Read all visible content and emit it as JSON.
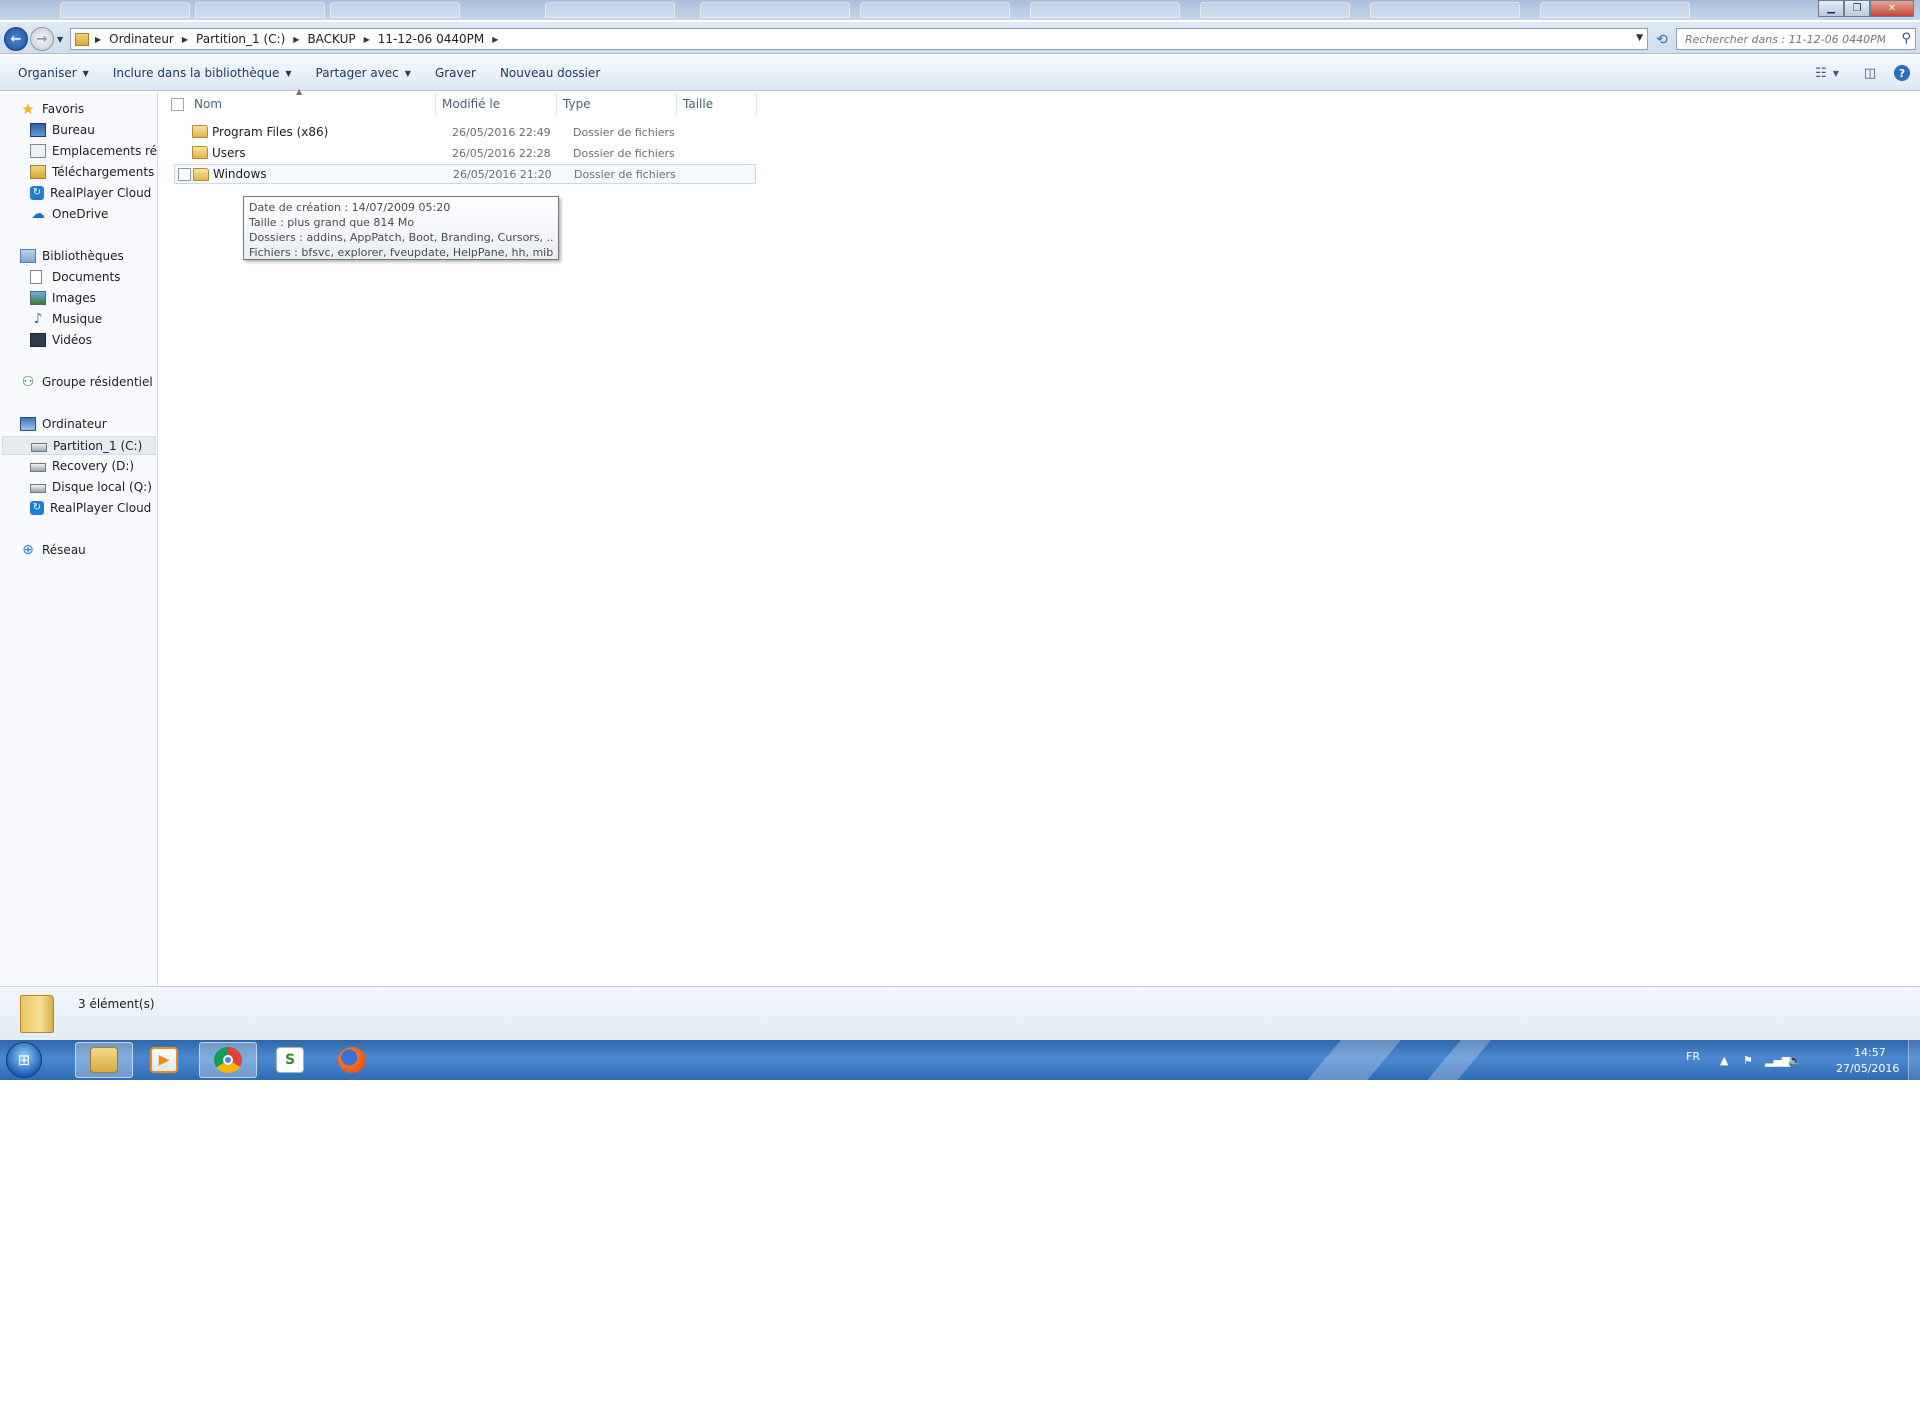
{
  "window": {
    "breadcrumbs": [
      "Ordinateur",
      "Partition_1 (C:)",
      "BACKUP",
      "11-12-06 0440PM"
    ],
    "search_placeholder": "Rechercher dans : 11-12-06 0440PM"
  },
  "toolbar": {
    "organize": "Organiser",
    "include_library": "Inclure dans la bibliothèque",
    "share_with": "Partager avec",
    "burn": "Graver",
    "new_folder": "Nouveau dossier"
  },
  "nav": {
    "favorites": {
      "label": "Favoris",
      "items": [
        "Bureau",
        "Emplacements récents",
        "Téléchargements",
        "RealPlayer Cloud",
        "OneDrive"
      ]
    },
    "libraries": {
      "label": "Bibliothèques",
      "items": [
        "Documents",
        "Images",
        "Musique",
        "Vidéos"
      ]
    },
    "homegroup": "Groupe résidentiel",
    "computer": {
      "label": "Ordinateur",
      "items": [
        "Partition_1 (C:)",
        "Recovery (D:)",
        "Disque local (Q:)",
        "RealPlayer Cloud"
      ],
      "selected": "Partition_1 (C:)"
    },
    "network": "Réseau"
  },
  "columns": [
    "Nom",
    "Modifié le",
    "Type",
    "Taille"
  ],
  "files": [
    {
      "name": "Program Files (x86)",
      "modified": "26/05/2016 22:49",
      "type": "Dossier de fichiers",
      "size": ""
    },
    {
      "name": "Users",
      "modified": "26/05/2016 22:28",
      "type": "Dossier de fichiers",
      "size": ""
    },
    {
      "name": "Windows",
      "modified": "26/05/2016 21:20",
      "type": "Dossier de fichiers",
      "size": ""
    }
  ],
  "tooltip": {
    "created": "Date de création : 14/07/2009 05:20",
    "size": "Taille : plus grand que 814 Mo",
    "folders": "Dossiers : addins, AppPatch, Boot, Branding, Cursors, ...",
    "files": "Fichiers : bfsvc, explorer, fveupdate, HelpPane, hh, mib, ..."
  },
  "status": {
    "item_count": "3 élément(s)"
  },
  "taskbar": {
    "apps": [
      "explorer-icon",
      "media-player-icon",
      "chrome-icon",
      "app-s-icon",
      "firefox-icon"
    ],
    "app_s_letter": "S",
    "language": "FR",
    "time": "14:57",
    "date": "27/05/2016"
  },
  "colors": {
    "accent": "#2e6bc1",
    "taskbar": "#3a78c2",
    "folder": "#e9c25a"
  }
}
